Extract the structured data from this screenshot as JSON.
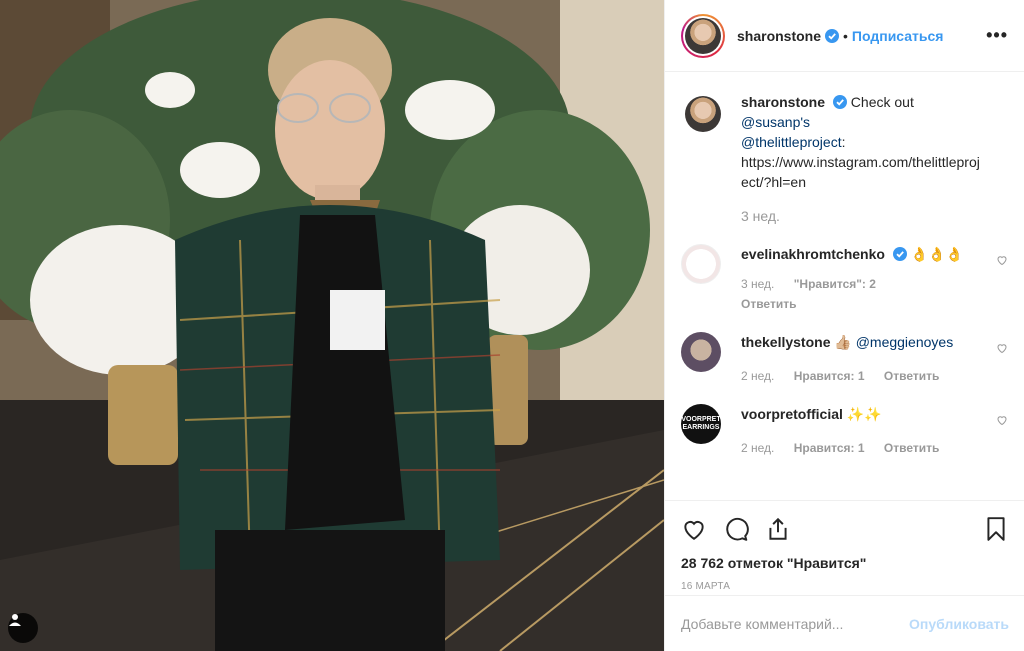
{
  "header": {
    "username": "sharonstone",
    "separator": "•",
    "follow_label": "Подписаться",
    "more_label": "•••"
  },
  "caption": {
    "username": "sharonstone",
    "text_prefix": "Check out",
    "mention1": "@susanp's",
    "mention2": "@thelittleproject",
    "colon": ":",
    "url": "https://www.instagram.com/thelittleproject/?hl=en",
    "time": "3 нед."
  },
  "comments": [
    {
      "username": "evelinakhromtchenko",
      "text": "👌👌👌",
      "time": "3 нед.",
      "likes": "\"Нравится\": 2",
      "reply": "Ответить"
    },
    {
      "username": "thekellystone",
      "text": "👍🏼 ",
      "mention": "@meggienoyes",
      "time": "2 нед.",
      "likes": "Нравится: 1",
      "reply": "Ответить"
    },
    {
      "username": "voorpretofficial",
      "avatar_text": "VOORPRET EARRINGS",
      "text": "✨✨",
      "time": "2 нед.",
      "likes": "Нравится: 1",
      "reply": "Ответить"
    }
  ],
  "post": {
    "likes": "28 762 отметок \"Нравится\"",
    "date": "16 МАРТА"
  },
  "add_comment": {
    "placeholder": "Добавьте комментарий...",
    "publish_label": "Опубликовать"
  },
  "colors": {
    "link": "#003569",
    "accent": "#3897f0",
    "verified": "#3897f0"
  },
  "icons": [
    "heart-icon",
    "comment-icon",
    "share-icon",
    "bookmark-icon",
    "verified-badge-icon",
    "user-tag-icon",
    "more-options-icon"
  ]
}
